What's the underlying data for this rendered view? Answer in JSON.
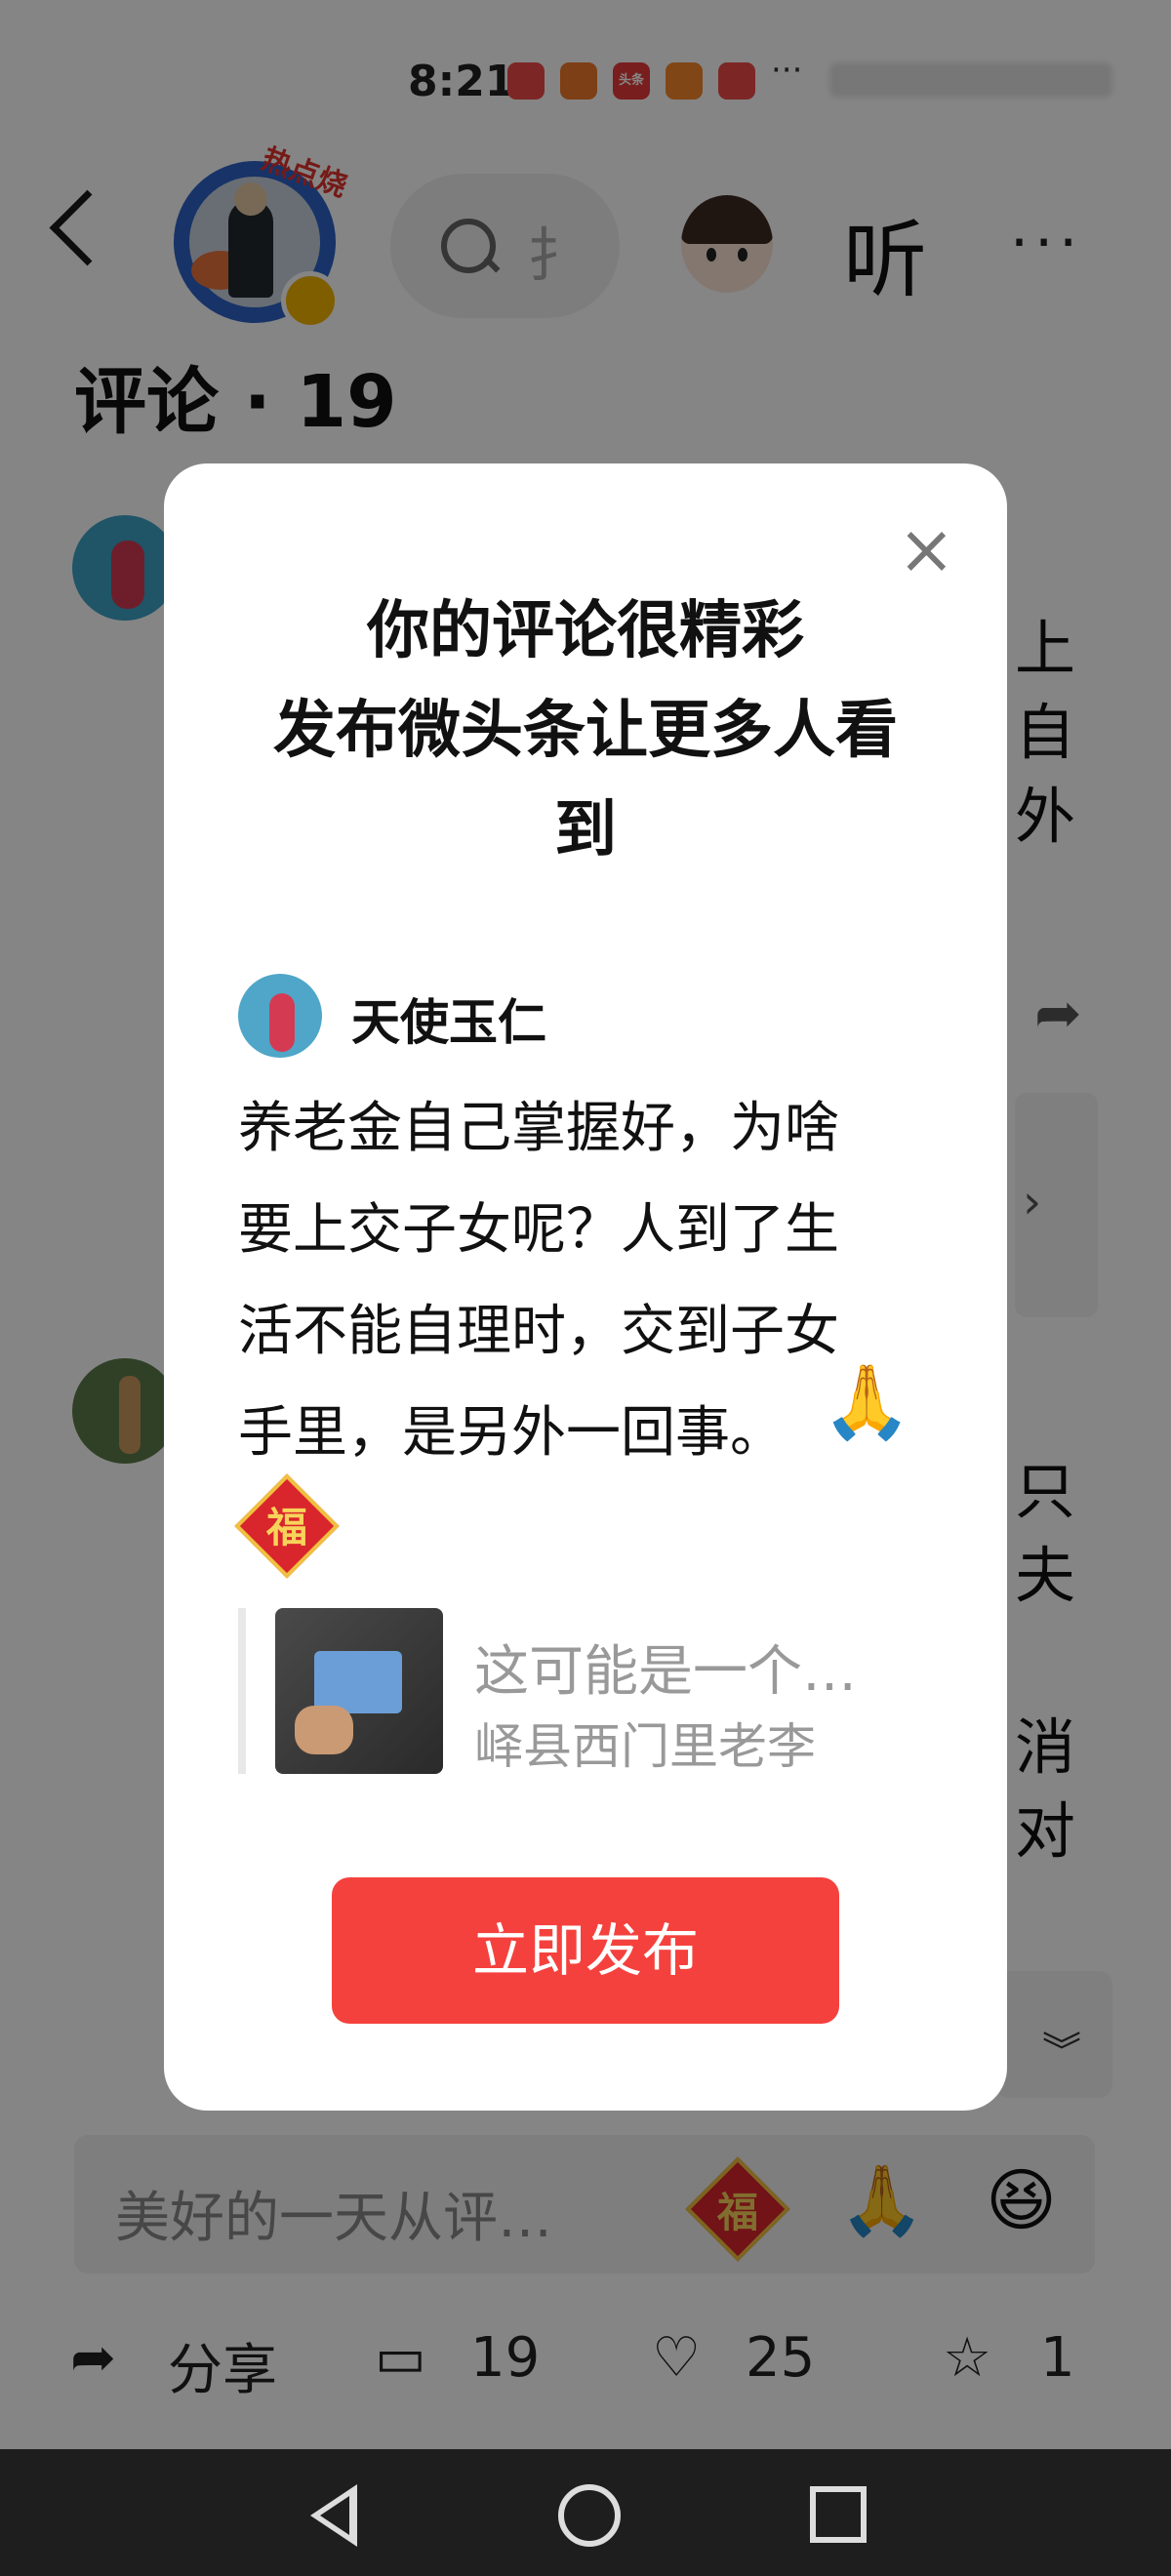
{
  "status_bar": {
    "time": "8:21",
    "app_icons": [
      {
        "name": "huawei-store-icon",
        "label": "HUAWEI",
        "color": "#f04a4a"
      },
      {
        "name": "app-88-icon",
        "label": "88",
        "color": "#f07a2a"
      },
      {
        "name": "toutiao-icon",
        "label": "头条",
        "color": "#e83a3a"
      },
      {
        "name": "app-orange-icon",
        "label": "人",
        "color": "#f5862a"
      },
      {
        "name": "huawei-store-icon-2",
        "label": "HUAWEI",
        "color": "#f04a4a"
      }
    ],
    "more": "···"
  },
  "header": {
    "hot_tag": "热点烧",
    "search_stub": "扌",
    "listen_label": "听",
    "more_label": "···"
  },
  "comments": {
    "title": "评论 · 19",
    "background_fragments": [
      "上",
      "自",
      "外",
      "只",
      "夫",
      "消",
      "对"
    ]
  },
  "dialog": {
    "title_line1": "你的评论很精彩",
    "title_line2": "发布微头条让更多人看",
    "title_line3": "到",
    "close_label": "×",
    "author": "天使玉仁",
    "comment_lines": [
      "养老金自己掌握好，为啥",
      "要上交子女呢？人到了生",
      "活不能自理时，交到子女",
      "手里，是另外一回事。"
    ],
    "pray_emoji": "🙏",
    "fu_char": "福",
    "quote_title": "这可能是一个…",
    "quote_author": "峄县西门里老李",
    "publish_label": "立即发布"
  },
  "input_bar": {
    "placeholder": "美好的一天从评…",
    "fu_char": "福",
    "pray_emoji": "🙏",
    "laugh_emoji": "😆"
  },
  "actions": {
    "share_label": "分享",
    "comment_count": "19",
    "like_count": "25",
    "favorite_count": "1"
  },
  "colors": {
    "accent": "#f5413d",
    "overlay": "rgba(0,0,0,0.48)"
  }
}
